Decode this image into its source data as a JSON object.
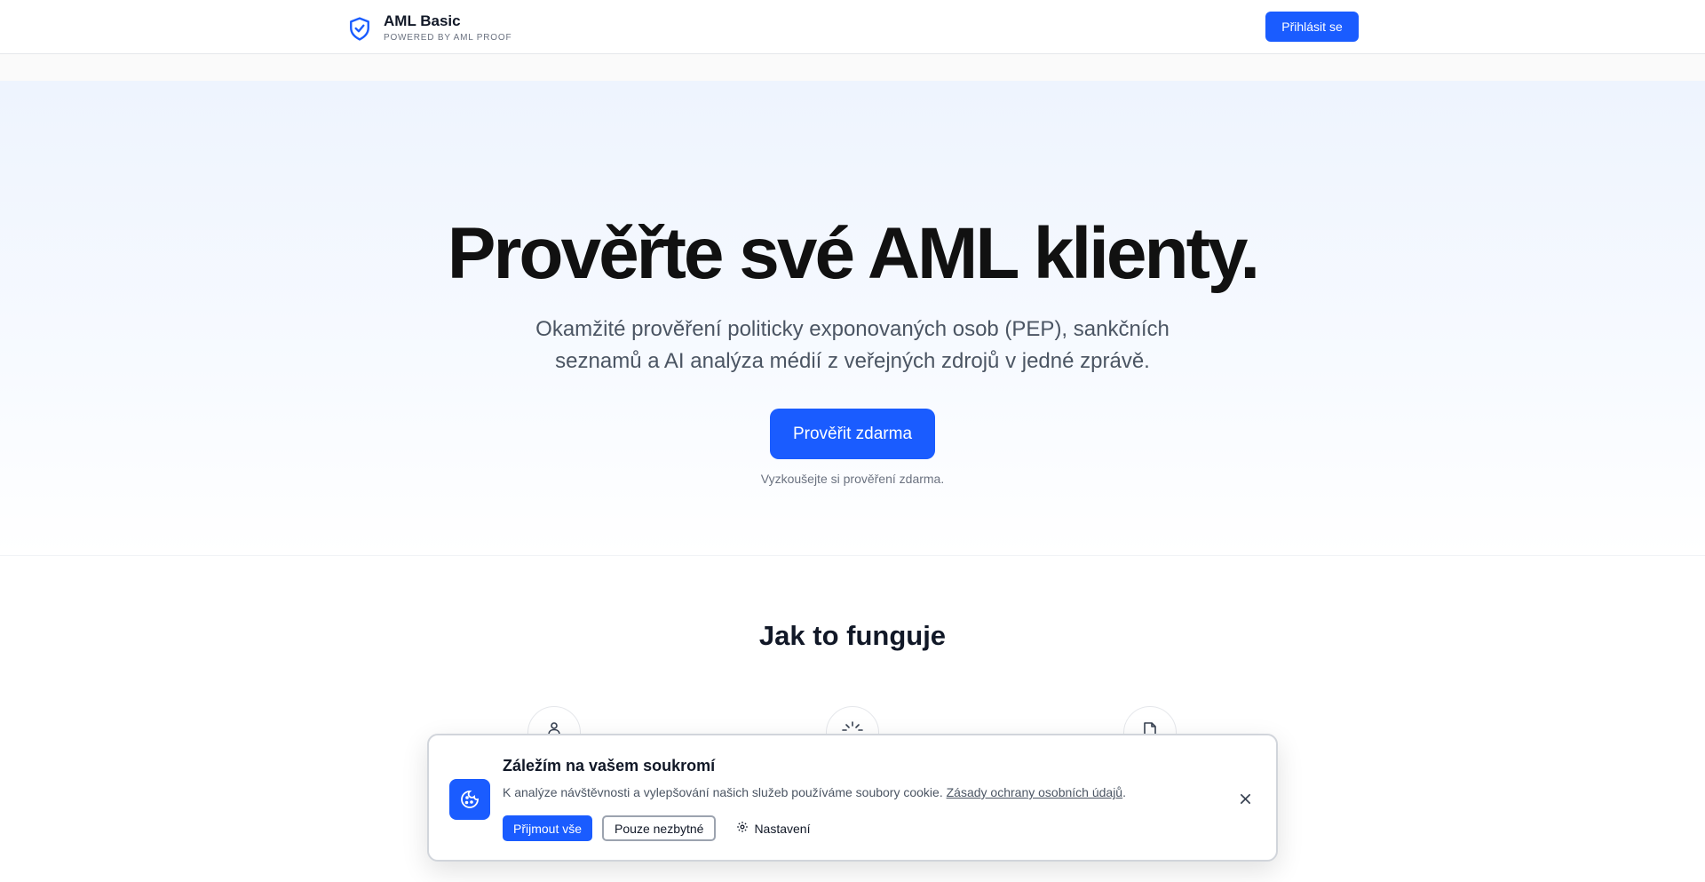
{
  "header": {
    "brand_name": "AML Basic",
    "brand_sub": "POWERED BY AML PROOF",
    "login_label": "Přihlásit se"
  },
  "hero": {
    "title": "Prověřte své AML klienty.",
    "subtitle": "Okamžité prověření politicky exponovaných osob (PEP), sankčních seznamů a AI analýza médií z veřejných zdrojů v jedné zprávě.",
    "cta_label": "Prověřit zdarma",
    "cta_note": "Vyzkoušejte si prověření zdarma."
  },
  "how": {
    "title": "Jak to funguje",
    "steps": [
      {
        "icon": "user-icon"
      },
      {
        "icon": "loader-icon"
      },
      {
        "icon": "file-icon"
      }
    ]
  },
  "cookie": {
    "title": "Záležím na vašem soukromí",
    "text": "K analýze návštěvnosti a vylepšování našich služeb používáme soubory cookie.",
    "link": "Zásady ochrany osobních údajů",
    "text_end": ".",
    "accept_label": "Přijmout vše",
    "necessary_label": "Pouze nezbytné",
    "settings_label": "Nastavení"
  },
  "colors": {
    "accent": "#1a5cff",
    "text": "#111827",
    "muted": "#6b7280"
  }
}
